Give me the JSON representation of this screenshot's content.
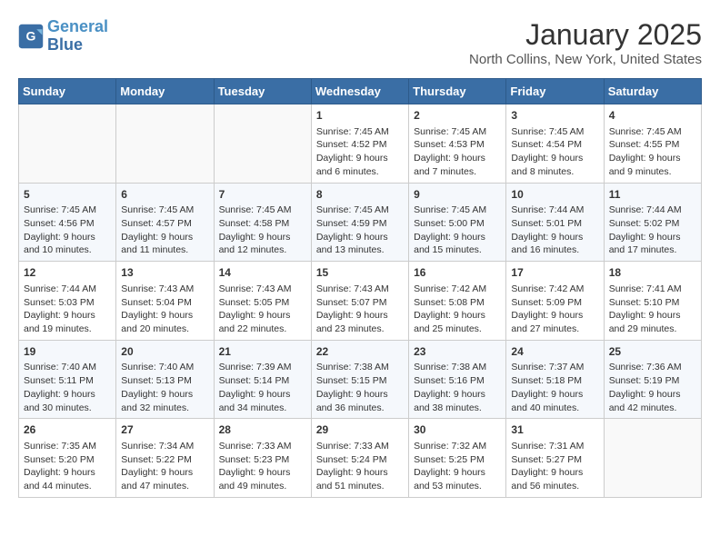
{
  "header": {
    "logo_line1": "General",
    "logo_line2": "Blue",
    "title": "January 2025",
    "subtitle": "North Collins, New York, United States"
  },
  "days_of_week": [
    "Sunday",
    "Monday",
    "Tuesday",
    "Wednesday",
    "Thursday",
    "Friday",
    "Saturday"
  ],
  "weeks": [
    [
      {
        "day": "",
        "info": ""
      },
      {
        "day": "",
        "info": ""
      },
      {
        "day": "",
        "info": ""
      },
      {
        "day": "1",
        "info": "Sunrise: 7:45 AM\nSunset: 4:52 PM\nDaylight: 9 hours and 6 minutes."
      },
      {
        "day": "2",
        "info": "Sunrise: 7:45 AM\nSunset: 4:53 PM\nDaylight: 9 hours and 7 minutes."
      },
      {
        "day": "3",
        "info": "Sunrise: 7:45 AM\nSunset: 4:54 PM\nDaylight: 9 hours and 8 minutes."
      },
      {
        "day": "4",
        "info": "Sunrise: 7:45 AM\nSunset: 4:55 PM\nDaylight: 9 hours and 9 minutes."
      }
    ],
    [
      {
        "day": "5",
        "info": "Sunrise: 7:45 AM\nSunset: 4:56 PM\nDaylight: 9 hours and 10 minutes."
      },
      {
        "day": "6",
        "info": "Sunrise: 7:45 AM\nSunset: 4:57 PM\nDaylight: 9 hours and 11 minutes."
      },
      {
        "day": "7",
        "info": "Sunrise: 7:45 AM\nSunset: 4:58 PM\nDaylight: 9 hours and 12 minutes."
      },
      {
        "day": "8",
        "info": "Sunrise: 7:45 AM\nSunset: 4:59 PM\nDaylight: 9 hours and 13 minutes."
      },
      {
        "day": "9",
        "info": "Sunrise: 7:45 AM\nSunset: 5:00 PM\nDaylight: 9 hours and 15 minutes."
      },
      {
        "day": "10",
        "info": "Sunrise: 7:44 AM\nSunset: 5:01 PM\nDaylight: 9 hours and 16 minutes."
      },
      {
        "day": "11",
        "info": "Sunrise: 7:44 AM\nSunset: 5:02 PM\nDaylight: 9 hours and 17 minutes."
      }
    ],
    [
      {
        "day": "12",
        "info": "Sunrise: 7:44 AM\nSunset: 5:03 PM\nDaylight: 9 hours and 19 minutes."
      },
      {
        "day": "13",
        "info": "Sunrise: 7:43 AM\nSunset: 5:04 PM\nDaylight: 9 hours and 20 minutes."
      },
      {
        "day": "14",
        "info": "Sunrise: 7:43 AM\nSunset: 5:05 PM\nDaylight: 9 hours and 22 minutes."
      },
      {
        "day": "15",
        "info": "Sunrise: 7:43 AM\nSunset: 5:07 PM\nDaylight: 9 hours and 23 minutes."
      },
      {
        "day": "16",
        "info": "Sunrise: 7:42 AM\nSunset: 5:08 PM\nDaylight: 9 hours and 25 minutes."
      },
      {
        "day": "17",
        "info": "Sunrise: 7:42 AM\nSunset: 5:09 PM\nDaylight: 9 hours and 27 minutes."
      },
      {
        "day": "18",
        "info": "Sunrise: 7:41 AM\nSunset: 5:10 PM\nDaylight: 9 hours and 29 minutes."
      }
    ],
    [
      {
        "day": "19",
        "info": "Sunrise: 7:40 AM\nSunset: 5:11 PM\nDaylight: 9 hours and 30 minutes."
      },
      {
        "day": "20",
        "info": "Sunrise: 7:40 AM\nSunset: 5:13 PM\nDaylight: 9 hours and 32 minutes."
      },
      {
        "day": "21",
        "info": "Sunrise: 7:39 AM\nSunset: 5:14 PM\nDaylight: 9 hours and 34 minutes."
      },
      {
        "day": "22",
        "info": "Sunrise: 7:38 AM\nSunset: 5:15 PM\nDaylight: 9 hours and 36 minutes."
      },
      {
        "day": "23",
        "info": "Sunrise: 7:38 AM\nSunset: 5:16 PM\nDaylight: 9 hours and 38 minutes."
      },
      {
        "day": "24",
        "info": "Sunrise: 7:37 AM\nSunset: 5:18 PM\nDaylight: 9 hours and 40 minutes."
      },
      {
        "day": "25",
        "info": "Sunrise: 7:36 AM\nSunset: 5:19 PM\nDaylight: 9 hours and 42 minutes."
      }
    ],
    [
      {
        "day": "26",
        "info": "Sunrise: 7:35 AM\nSunset: 5:20 PM\nDaylight: 9 hours and 44 minutes."
      },
      {
        "day": "27",
        "info": "Sunrise: 7:34 AM\nSunset: 5:22 PM\nDaylight: 9 hours and 47 minutes."
      },
      {
        "day": "28",
        "info": "Sunrise: 7:33 AM\nSunset: 5:23 PM\nDaylight: 9 hours and 49 minutes."
      },
      {
        "day": "29",
        "info": "Sunrise: 7:33 AM\nSunset: 5:24 PM\nDaylight: 9 hours and 51 minutes."
      },
      {
        "day": "30",
        "info": "Sunrise: 7:32 AM\nSunset: 5:25 PM\nDaylight: 9 hours and 53 minutes."
      },
      {
        "day": "31",
        "info": "Sunrise: 7:31 AM\nSunset: 5:27 PM\nDaylight: 9 hours and 56 minutes."
      },
      {
        "day": "",
        "info": ""
      }
    ]
  ]
}
